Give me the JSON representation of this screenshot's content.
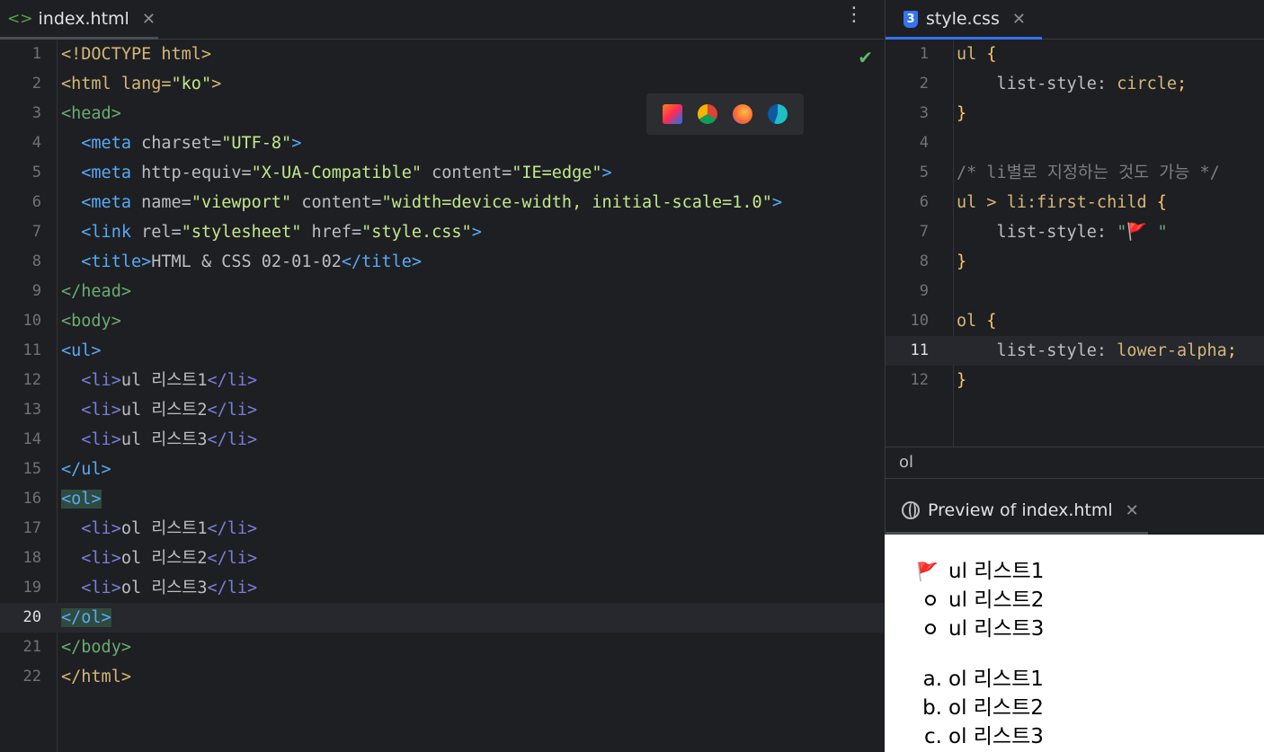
{
  "left_editor": {
    "tab": {
      "label": "index.html",
      "icon": "html-file-icon"
    },
    "lines": [
      {
        "n": "1"
      },
      {
        "n": "2"
      },
      {
        "n": "3"
      },
      {
        "n": "4"
      },
      {
        "n": "5"
      },
      {
        "n": "6"
      },
      {
        "n": "7"
      },
      {
        "n": "8"
      },
      {
        "n": "9"
      },
      {
        "n": "10"
      },
      {
        "n": "11"
      },
      {
        "n": "12"
      },
      {
        "n": "13"
      },
      {
        "n": "14"
      },
      {
        "n": "15"
      },
      {
        "n": "16"
      },
      {
        "n": "17"
      },
      {
        "n": "18"
      },
      {
        "n": "19"
      },
      {
        "n": "20"
      },
      {
        "n": "21"
      },
      {
        "n": "22"
      }
    ],
    "code": {
      "l1": "<!DOCTYPE html>",
      "l2_open": "<html lang=",
      "l2_val": "\"ko\"",
      "l2_close": ">",
      "l3": "<head>",
      "l4_tag": "<meta",
      "l4_attr": " charset=",
      "l4_val": "\"UTF-8\"",
      "l4_close": ">",
      "l5_tag": "<meta",
      "l5_attr": " http-equiv=",
      "l5_val": "\"X-UA-Compatible\"",
      "l5_attr2": " content=",
      "l5_val2": "\"IE=edge\"",
      "l5_close": ">",
      "l6_tag": "<meta",
      "l6_attr": " name=",
      "l6_val": "\"viewport\"",
      "l6_attr2": " content=",
      "l6_val2": "\"width=device-width, initial-scale=1.0\"",
      "l6_close": ">",
      "l7_tag": "<link",
      "l7_attr": " rel=",
      "l7_val": "\"stylesheet\"",
      "l7_attr2": " href=",
      "l7_val2": "\"style.css\"",
      "l7_close": ">",
      "l8_open": "<title>",
      "l8_text": "HTML & CSS 02-01-02",
      "l8_close": "</title>",
      "l9": "</head>",
      "l10": "<body>",
      "l11": "<ul>",
      "l12_open": "<li>",
      "l12_text": "ul 리스트1",
      "l12_close": "</li>",
      "l13_open": "<li>",
      "l13_text": "ul 리스트2",
      "l13_close": "</li>",
      "l14_open": "<li>",
      "l14_text": "ul 리스트3",
      "l14_close": "</li>",
      "l15": "</ul>",
      "l16": "<ol>",
      "l17_open": "<li>",
      "l17_text": "ol 리스트1",
      "l17_close": "</li>",
      "l18_open": "<li>",
      "l18_text": "ol 리스트2",
      "l18_close": "</li>",
      "l19_open": "<li>",
      "l19_text": "ol 리스트3",
      "l19_close": "</li>",
      "l20": "</ol>",
      "l21": "</body>",
      "l22": "</html>"
    },
    "current_line": "20"
  },
  "right_editor": {
    "tab": {
      "label": "style.css",
      "icon": "css-file-icon"
    },
    "lines": [
      "1",
      "2",
      "3",
      "4",
      "5",
      "6",
      "7",
      "8",
      "9",
      "10",
      "11",
      "12"
    ],
    "code": {
      "l1_sel": "ul",
      "l1_brace": " {",
      "l2_prop": "    list-style:",
      "l2_val": " circle",
      "l2_semi": ";",
      "l3": "}",
      "l5": "/* li별로 지정하는 것도 가능 */",
      "l6_sel": "ul > li",
      "l6_pseudo": ":first-child",
      "l6_brace": " {",
      "l7_prop": "    list-style:",
      "l7_val": " \"🚩 \"",
      "l8": "}",
      "l10_sel": "ol",
      "l10_brace": " {",
      "l11_prop": "    list-style:",
      "l11_val": " lower-alpha",
      "l11_semi": ";",
      "l12": "}"
    },
    "current_line": "11"
  },
  "breadcrumb": "ol",
  "preview": {
    "tab_label": "Preview of index.html",
    "ul_items": [
      "ul 리스트1",
      "ul 리스트2",
      "ul 리스트3"
    ],
    "ul_first_marker": "🚩",
    "ol_markers": [
      "a.",
      "b.",
      "c."
    ],
    "ol_items": [
      "ol 리스트1",
      "ol 리스트2",
      "ol 리스트3"
    ]
  },
  "browser_icons": [
    "intellij-icon",
    "chrome-icon",
    "firefox-icon",
    "edge-icon"
  ],
  "colors": {
    "accent": "#3574f0",
    "check": "#5fb865"
  }
}
